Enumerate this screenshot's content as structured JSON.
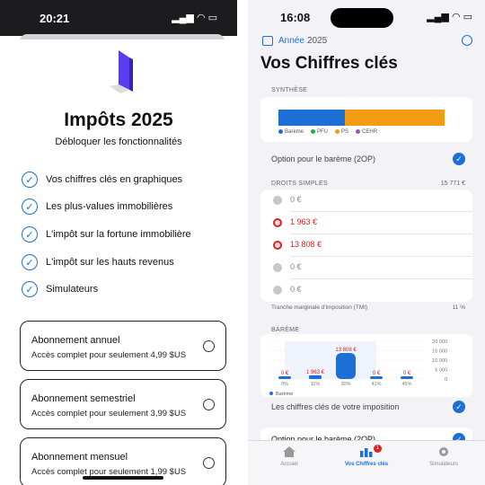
{
  "left": {
    "status_time": "20:21",
    "title": "Impôts 2025",
    "subtitle": "Débloquer les fonctionnalités",
    "features": [
      "Vos chiffres clés en graphiques",
      "Les plus-values immobilières",
      "L'impôt sur la fortune immobilière",
      "L'impôt sur les hauts revenus",
      "Simulateurs"
    ],
    "subscriptions": [
      {
        "name": "Abonnement annuel",
        "desc": "Accès complet pour seulement 4,99 $US"
      },
      {
        "name": "Abonnement semestriel",
        "desc": "Accès complet pour seulement 3,99 $US"
      },
      {
        "name": "Abonnement mensuel",
        "desc": "Accès complet pour seulement 1,99 $US"
      }
    ]
  },
  "right": {
    "status_time": "16:08",
    "year_button": "Année",
    "year": "2025",
    "title": "Vos Chiffres clés",
    "synthese": {
      "header": "SYNTHÈSE",
      "legend": [
        {
          "label": "Barème",
          "color": "#1d6fd6"
        },
        {
          "label": "PFU",
          "color": "#20b040"
        },
        {
          "label": "PS",
          "color": "#f39c12"
        },
        {
          "label": "CEHR",
          "color": "#9b59b6"
        }
      ],
      "option": "Option pour le barème (2OP)"
    },
    "droits": {
      "header": "DROITS SIMPLES",
      "total": "15 771 €",
      "rows": [
        {
          "value": "0 €",
          "state": "grey"
        },
        {
          "value": "1 963 €",
          "state": "red"
        },
        {
          "value": "13 808 €",
          "state": "red"
        },
        {
          "value": "0 €",
          "state": "grey"
        },
        {
          "value": "0 €",
          "state": "grey"
        }
      ],
      "tmi_label": "Tranche marginale d'imposition (TMI)",
      "tmi_value": "11 %"
    },
    "bareme": {
      "header": "BARÈME",
      "legend": "Barème",
      "option_chiffres": "Les chiffres clés de votre imposition",
      "option_bareme": "Option pour le barème (2OP)"
    },
    "tabs": [
      {
        "label": "Accueil"
      },
      {
        "label": "Vos Chiffres clés",
        "badge": "1"
      },
      {
        "label": "Simulateurs"
      }
    ]
  },
  "chart_data": {
    "type": "bar",
    "categories": [
      "0%",
      "11%",
      "30%",
      "41%",
      "45%"
    ],
    "values": [
      0,
      1963,
      13808,
      0,
      0
    ],
    "data_labels": [
      "0 €",
      "1 963 €",
      "13 808 €",
      "0 €",
      "0 €"
    ],
    "ylim": [
      0,
      20000
    ],
    "yticks": [
      "20 000",
      "15 000",
      "10 000",
      "5 000",
      "0"
    ],
    "legend": [
      "Barème"
    ],
    "color": "#1d6fd6"
  }
}
